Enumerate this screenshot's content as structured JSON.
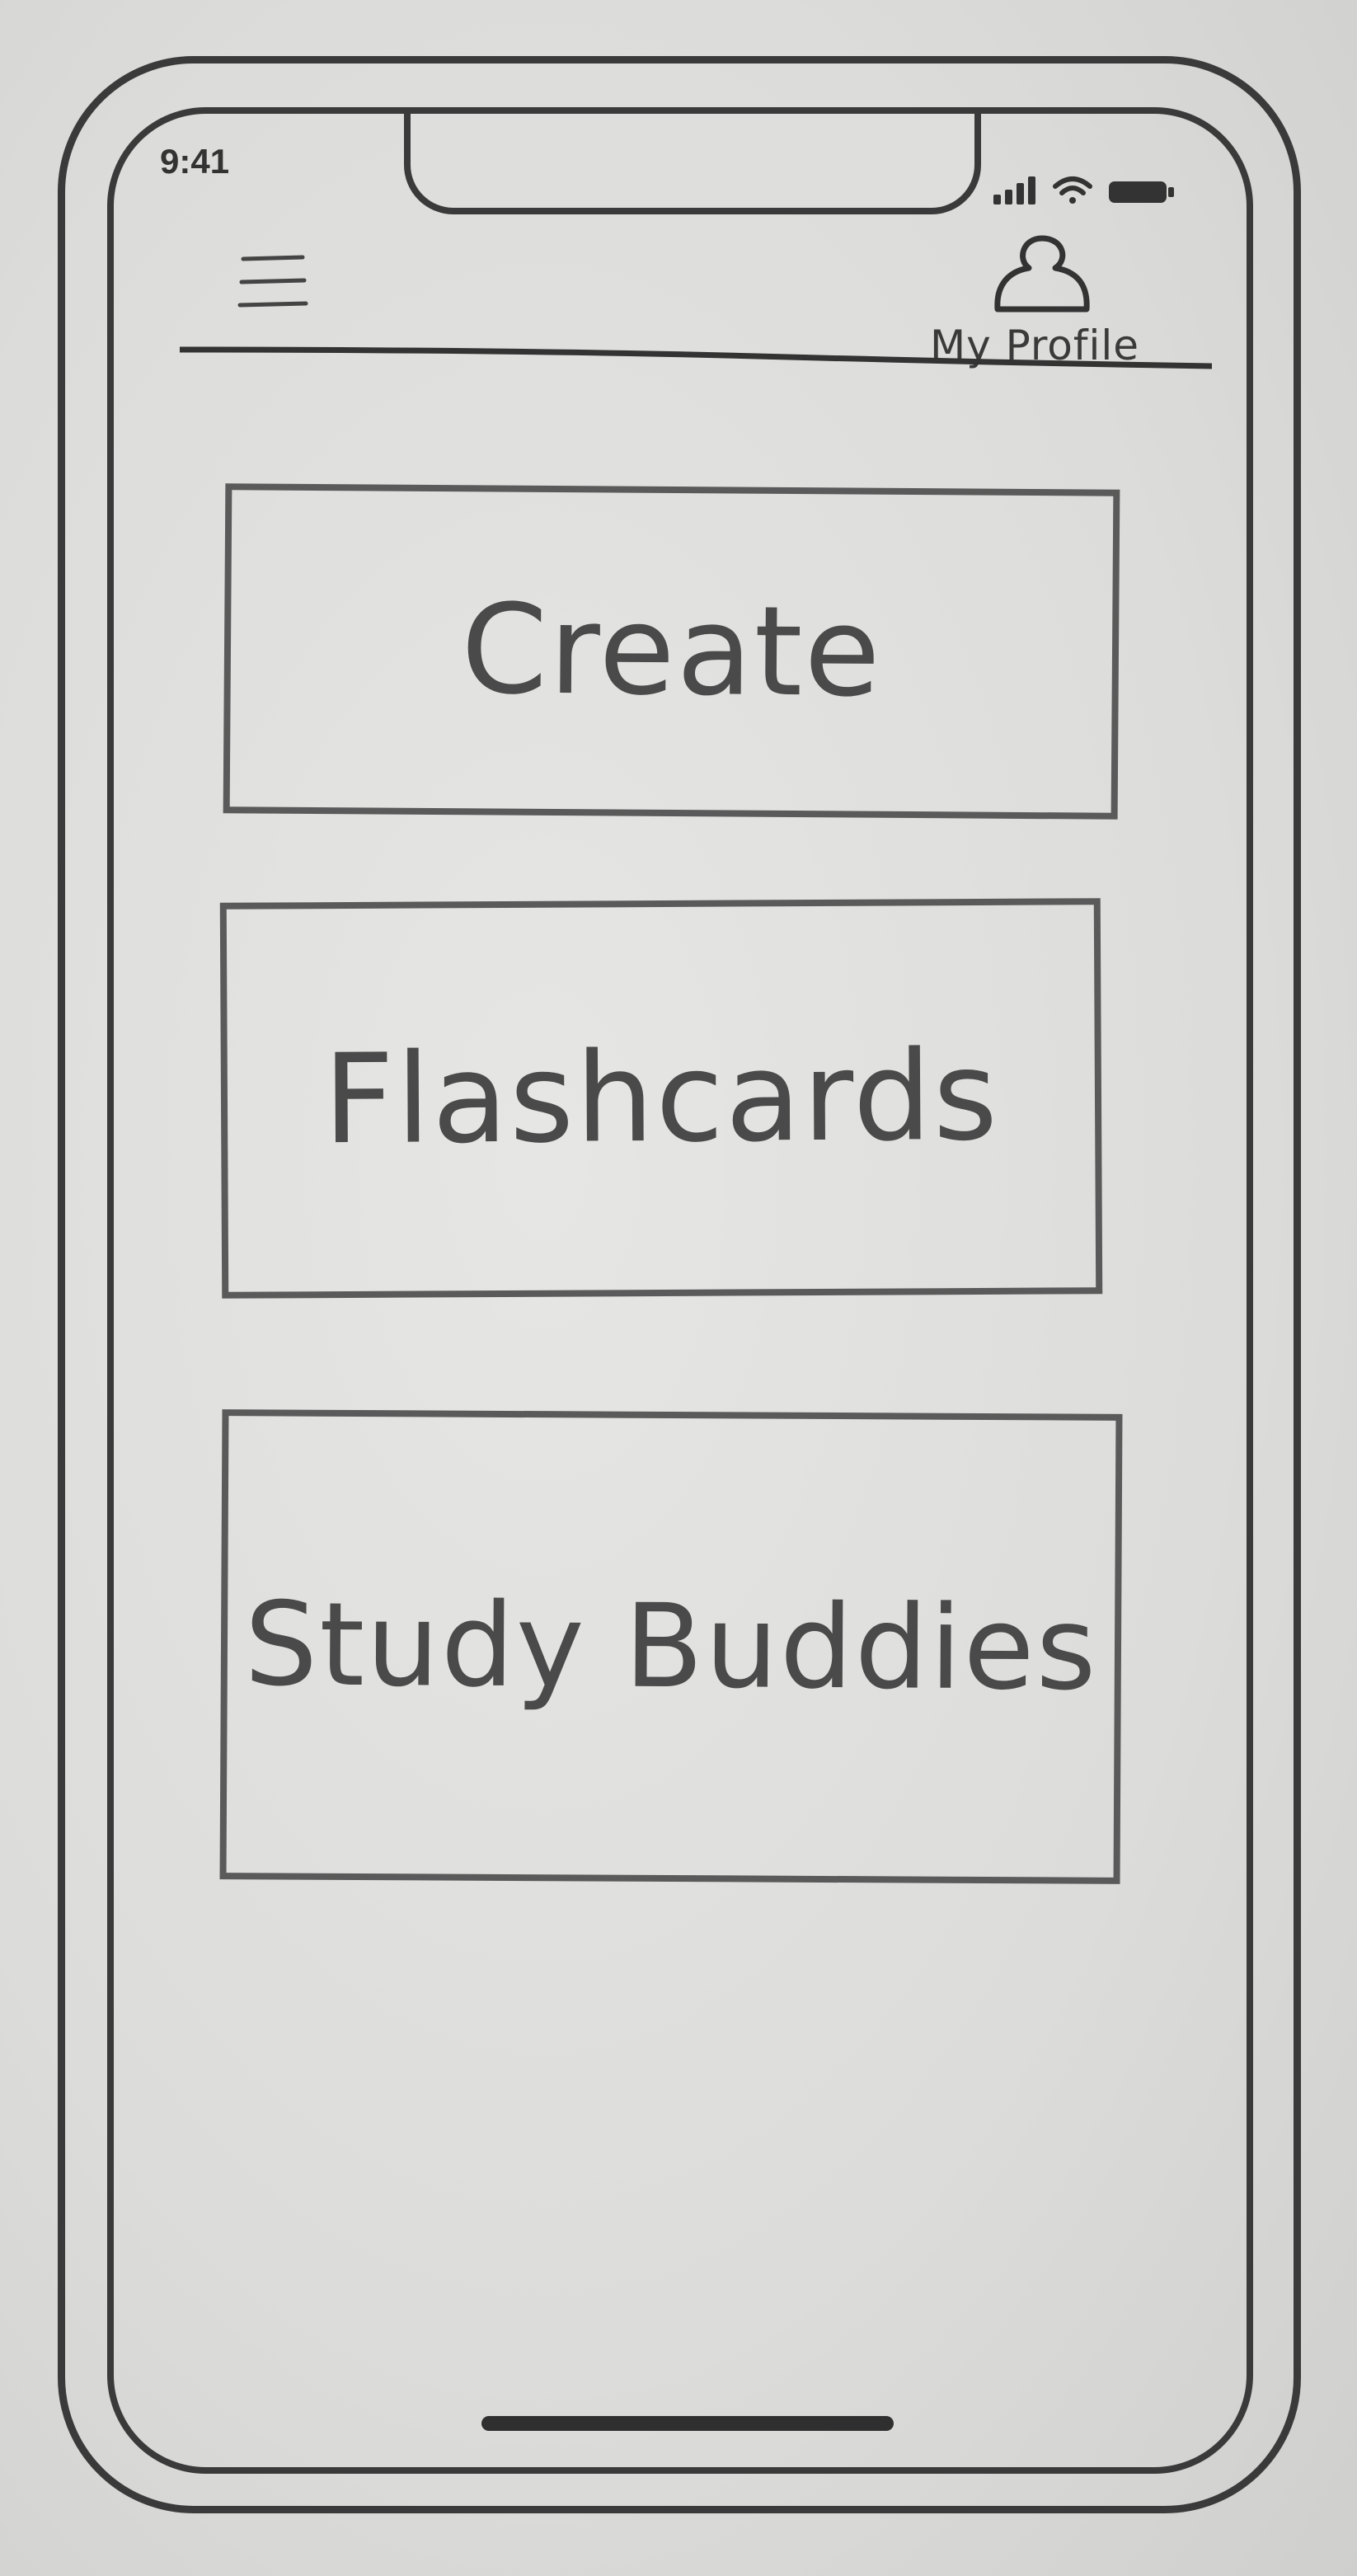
{
  "status_bar": {
    "time": "9:41",
    "icons": [
      "signal-icon",
      "wifi-icon",
      "battery-icon"
    ]
  },
  "header": {
    "menu_icon": "hamburger-menu-icon",
    "profile_icon": "user-silhouette-icon",
    "profile_label": "My Profile"
  },
  "main": {
    "cards": [
      {
        "label": "Create"
      },
      {
        "label": "Flashcards"
      },
      {
        "label": "Study Buddies"
      }
    ]
  },
  "colors": {
    "ink": "#3a3a3a",
    "paper": "#dcdcdb"
  }
}
